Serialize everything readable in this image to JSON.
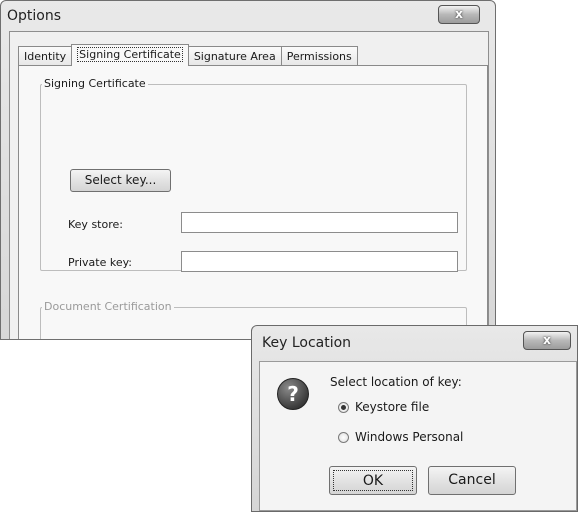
{
  "options_window": {
    "title": "Options",
    "close_glyph": "x",
    "tabs": [
      {
        "label": "Identity",
        "active": false
      },
      {
        "label": "Signing Certificate",
        "active": true
      },
      {
        "label": "Signature Area",
        "active": false
      },
      {
        "label": "Permissions",
        "active": false
      }
    ],
    "signing_group": {
      "label": "Signing Certificate",
      "select_key_button": "Select key...",
      "key_store_label": "Key store:",
      "key_store_value": "",
      "private_key_label": "Private key:",
      "private_key_value": ""
    },
    "document_group": {
      "label": "Document Certification"
    }
  },
  "key_location_dialog": {
    "title": "Key Location",
    "close_glyph": "x",
    "icon": "question-icon",
    "prompt": "Select location of key:",
    "options": [
      {
        "label": "Keystore file",
        "selected": true
      },
      {
        "label": "Windows Personal",
        "selected": false
      }
    ],
    "ok_label": "OK",
    "cancel_label": "Cancel"
  }
}
